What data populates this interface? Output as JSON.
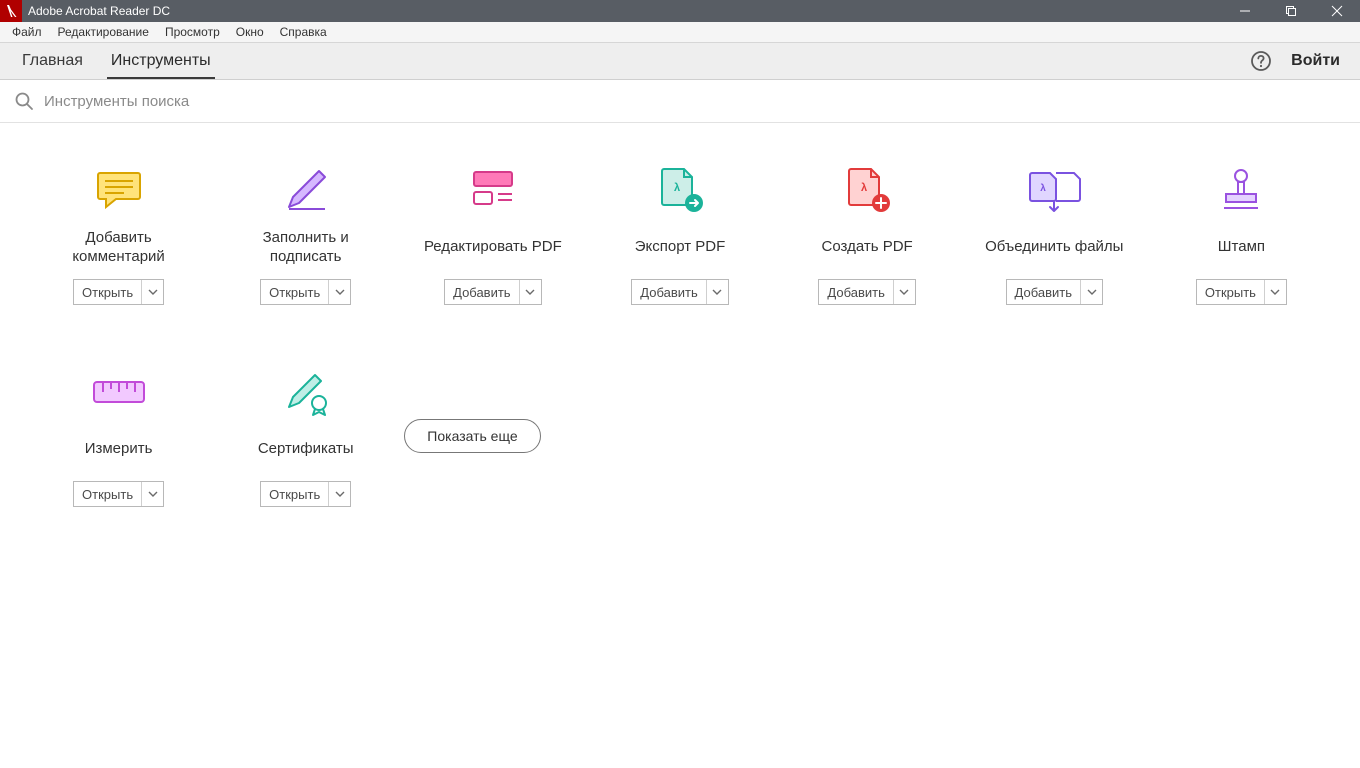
{
  "titlebar": {
    "title": "Adobe Acrobat Reader DC"
  },
  "menubar": {
    "items": [
      "Файл",
      "Редактирование",
      "Просмотр",
      "Окно",
      "Справка"
    ]
  },
  "tabbar": {
    "tabs": [
      {
        "label": "Главная"
      },
      {
        "label": "Инструменты"
      }
    ],
    "signin": "Войти"
  },
  "search": {
    "placeholder": "Инструменты поиска"
  },
  "tools": [
    {
      "icon": "comment",
      "label": "Добавить\nкомментарий",
      "action": "Открыть"
    },
    {
      "icon": "fillsign",
      "label": "Заполнить и\nподписать",
      "action": "Открыть"
    },
    {
      "icon": "editpdf",
      "label": "Редактировать PDF",
      "action": "Добавить"
    },
    {
      "icon": "export",
      "label": "Экспорт PDF",
      "action": "Добавить"
    },
    {
      "icon": "create",
      "label": "Создать PDF",
      "action": "Добавить"
    },
    {
      "icon": "combine",
      "label": "Объединить файлы",
      "action": "Добавить"
    },
    {
      "icon": "stamp",
      "label": "Штамп",
      "action": "Открыть"
    },
    {
      "icon": "measure",
      "label": "Измерить",
      "action": "Открыть"
    },
    {
      "icon": "cert",
      "label": "Сертификаты",
      "action": "Открыть"
    }
  ],
  "showmore": "Показать еще"
}
